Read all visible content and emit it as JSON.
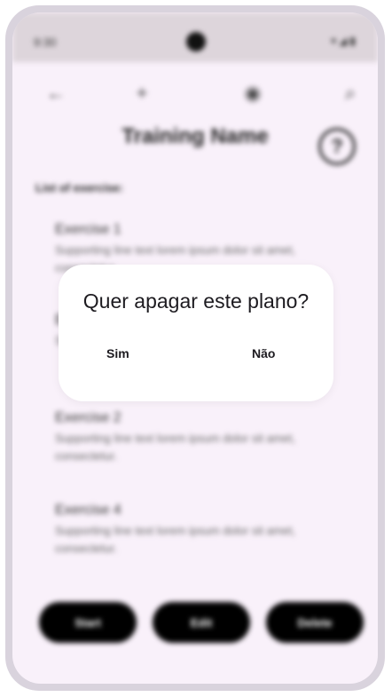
{
  "status_bar": {
    "time": "9:30",
    "icons": "▾◢▮"
  },
  "nav": {
    "back_icon": "←",
    "add_icon": "+",
    "profile_icon": "◉",
    "search_icon": "⌕"
  },
  "page": {
    "title": "Training Name",
    "help_icon": "?",
    "section_label": "List of exercise:"
  },
  "exercises": [
    {
      "title": "Exercise 1",
      "support": "Supporting line text lorem ipsum dolor sit amet, consectetur."
    },
    {
      "title": "E",
      "support": "S"
    },
    {
      "title": "Exercise 2",
      "support": "Supporting line text lorem ipsum dolor sit amet, consectetur."
    },
    {
      "title": "Exercise 4",
      "support": "Supporting line text lorem ipsum dolor sit amet, consectetur."
    }
  ],
  "actions": {
    "start": "Start",
    "edit": "Edit",
    "delete": "Delete"
  },
  "dialog": {
    "title": "Quer apagar este plano?",
    "confirm": "Sim",
    "cancel": "Não"
  }
}
